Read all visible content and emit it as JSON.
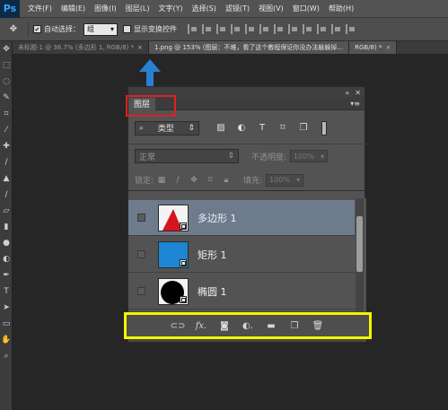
{
  "app": {
    "logo": "Ps"
  },
  "menu": [
    "文件(F)",
    "编辑(E)",
    "图像(I)",
    "图层(L)",
    "文字(Y)",
    "选择(S)",
    "滤镜(T)",
    "视图(V)",
    "窗口(W)",
    "帮助(H)"
  ],
  "options": {
    "auto_select_label": "自动选择：",
    "auto_select_value": "组",
    "auto_select_checked": "✔",
    "show_transform_label": "显示变换控件"
  },
  "tabs": [
    {
      "label": "未标题-1 @ 36.7% (多边形 1, RGB/8) *",
      "close": "×"
    },
    {
      "label": "1.png @ 153% (图层：不难，看了这个教程保证你没办法躲躲掉...",
      "close": "×"
    },
    {
      "label": "RGB/8) *",
      "close": "×"
    }
  ],
  "panel": {
    "tab_title": "图层",
    "filter_select": "类型",
    "filter_select_icon": "search-icon",
    "blend_mode": "正常",
    "opacity_label": "不透明度:",
    "opacity_value": "100%",
    "lock_label": "锁定:",
    "fill_label": "填充:",
    "fill_value": "100%",
    "layers": [
      {
        "name": "多边形 1",
        "selected": true
      },
      {
        "name": "矩形 1",
        "selected": false
      },
      {
        "name": "椭圆 1",
        "selected": false
      }
    ]
  },
  "colors": {
    "highlight_red": "#e02020",
    "highlight_yellow": "#f4f400",
    "arrow_blue": "#2a7fd4",
    "rect_blue": "#1c86d4",
    "polygon_red": "#d8141e"
  }
}
